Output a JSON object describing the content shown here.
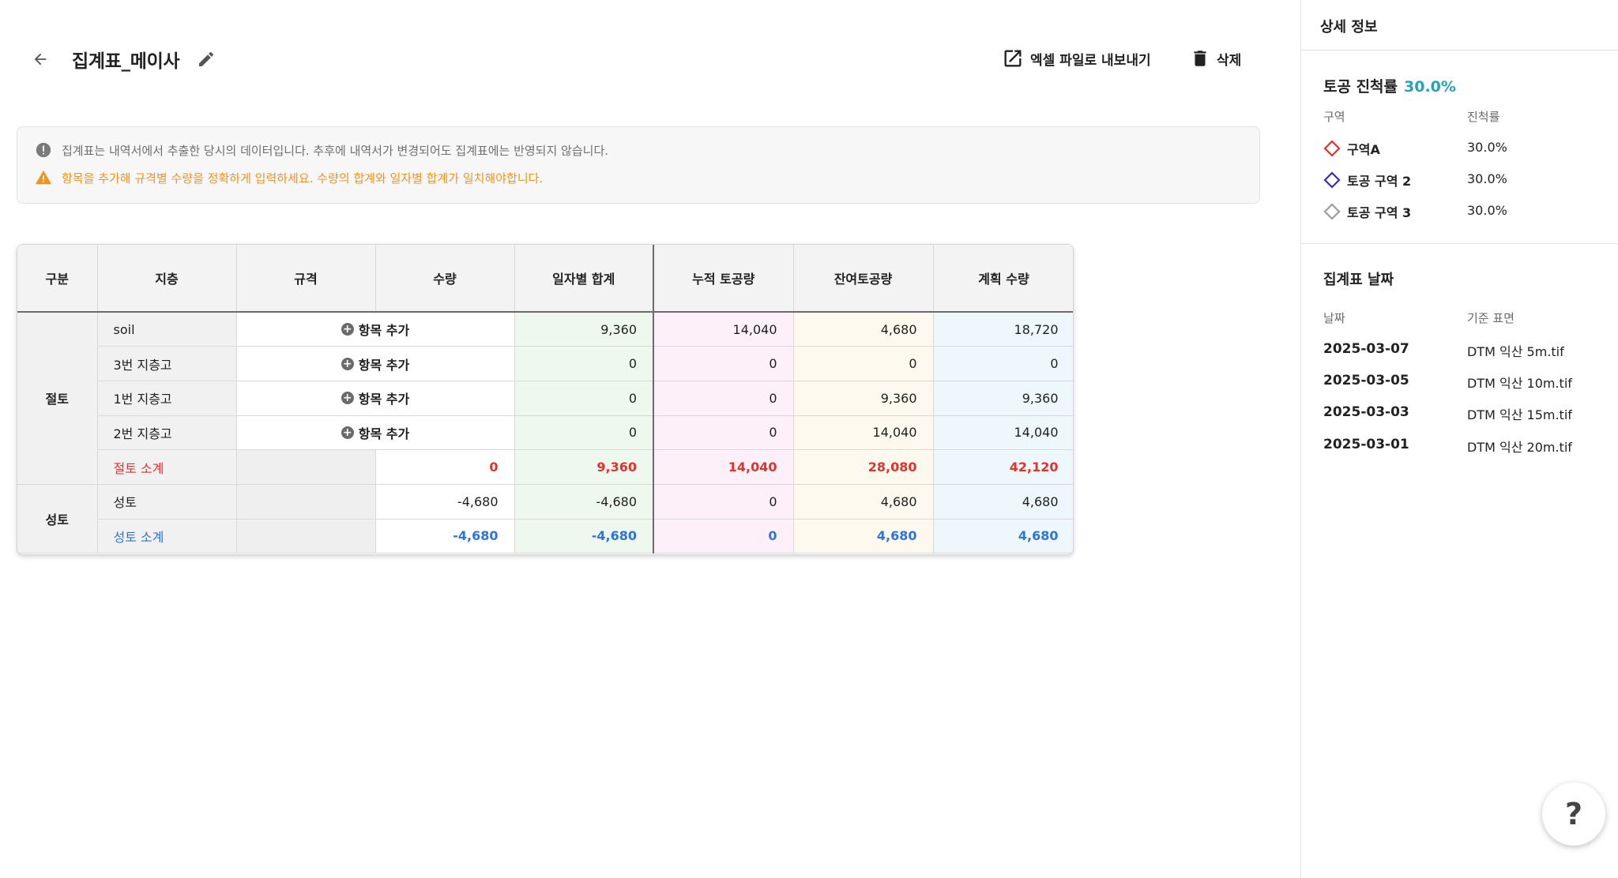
{
  "header": {
    "title": "집계표_메이사",
    "export_label": "엑셀 파일로 내보내기",
    "delete_label": "삭제"
  },
  "notice": {
    "info": "집계표는 내역서에서 추출한 당시의 데이터입니다. 추후에 내역서가 변경되어도 집계표에는 반영되지 않습니다.",
    "warning": "항목을 추가해 규격별 수량을 정확하게 입력하세요. 수량의 합계와 일자별 합계가 일치해야합니다."
  },
  "table": {
    "headers": [
      "구분",
      "지층",
      "규격",
      "수량",
      "일자별 합계",
      "누적 토공량",
      "잔여토공량",
      "계획 수량"
    ],
    "add_label": "항목 추가",
    "cut_group": "절토",
    "fill_group": "성토",
    "cut_rows": [
      {
        "layer": "soil",
        "daily": "9,360",
        "cum": "14,040",
        "remain": "4,680",
        "plan": "18,720"
      },
      {
        "layer": "3번 지층고",
        "daily": "0",
        "cum": "0",
        "remain": "0",
        "plan": "0"
      },
      {
        "layer": "1번 지층고",
        "daily": "0",
        "cum": "0",
        "remain": "9,360",
        "plan": "9,360"
      },
      {
        "layer": "2번 지층고",
        "daily": "0",
        "cum": "0",
        "remain": "14,040",
        "plan": "14,040"
      }
    ],
    "cut_subtotal": {
      "layer": "절토 소계",
      "qty": "0",
      "daily": "9,360",
      "cum": "14,040",
      "remain": "28,080",
      "plan": "42,120"
    },
    "fill_rows": [
      {
        "layer": "성토",
        "qty": "-4,680",
        "daily": "-4,680",
        "cum": "0",
        "remain": "4,680",
        "plan": "4,680"
      }
    ],
    "fill_subtotal": {
      "layer": "성토 소계",
      "qty": "-4,680",
      "daily": "-4,680",
      "cum": "0",
      "remain": "4,680",
      "plan": "4,680"
    }
  },
  "sidebar": {
    "title": "상세 정보",
    "progress_label": "토공 진척률",
    "progress_value": "30.0%",
    "zone_col": "구역",
    "rate_col": "진척률",
    "zones": [
      {
        "name": "구역A",
        "rate": "30.0%",
        "color": "#e3322d"
      },
      {
        "name": "토공 구역 2",
        "rate": "30.0%",
        "color": "#3b2fb0"
      },
      {
        "name": "토공 구역 3",
        "rate": "30.0%",
        "color": "#9a9aa8"
      }
    ],
    "dates_title": "집계표 날짜",
    "date_col": "날짜",
    "surface_col": "기준 표면",
    "dates": [
      {
        "date": "2025-03-07",
        "surface": "DTM 익산 5m.tif"
      },
      {
        "date": "2025-03-05",
        "surface": "DTM 익산 10m.tif"
      },
      {
        "date": "2025-03-03",
        "surface": "DTM 익산 15m.tif"
      },
      {
        "date": "2025-03-01",
        "surface": "DTM 익산 20m.tif"
      }
    ]
  },
  "help": "?"
}
